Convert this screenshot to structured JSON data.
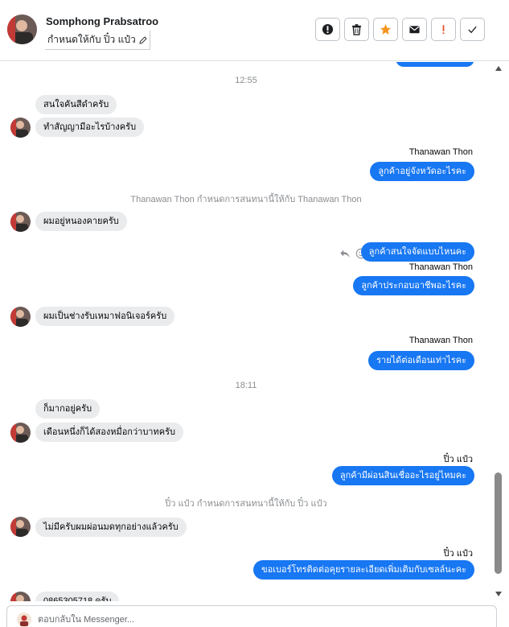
{
  "header": {
    "contact_name": "Somphong Prabsatroo",
    "assign_label": "กำหนดให้กับ ปิ๋ว แป๋ว",
    "toolbar": [
      {
        "name": "report-button",
        "icon": "exclamation-circle-icon"
      },
      {
        "name": "delete-button",
        "icon": "trash-icon"
      },
      {
        "name": "star-button",
        "icon": "star-icon"
      },
      {
        "name": "mark-unread-button",
        "icon": "envelope-icon"
      },
      {
        "name": "spam-button",
        "icon": "exclamation-icon"
      },
      {
        "name": "done-button",
        "icon": "check-icon"
      }
    ]
  },
  "conversation": {
    "timestamp1": "12:55",
    "m1": "สนใจคันสีดำครับ",
    "m2": "ทำสัญญามีอะไรบ้างครับ",
    "sender1": "Thanawan Thon",
    "m3": "ลูกค้าอยู่จังหวัดอะไรคะ",
    "note1": "Thanawan Thon กำหนดการสนทนานี้ให้กับ Thanawan Thon",
    "m4": "ผมอยู่หนองคายครับ",
    "m5": "ลูกค้าสนใจจัดแบบไหนคะ",
    "sender2": "Thanawan Thon",
    "m6": "ลูกค้าประกอบอาชีพอะไรคะ",
    "m7": "ผมเป็นช่างรับเหมาฟอนิเจอร์ครับ",
    "sender3": "Thanawan Thon",
    "m8": "รายได้ต่อเดือนเท่าไรคะ",
    "timestamp2": "18:11",
    "m9": "ก็มากอยู่ครับ",
    "m10": "เดือนหนึ่งก็ได้สองหมื่อกว่าบาทครับ",
    "sender4": "ปิ๋ว แป๋ว",
    "m11": "ลูกค้ามีผ่อนสินเชื่ออะไรอยู่ไหมคะ",
    "note2": "ปิ๋ว แป๋ว กำหนดการสนทนานี้ให้กับ ปิ๋ว แป๋ว",
    "m12": "ไม่มีครับผมผ่อนมดทุกอย่างแล้วครับ",
    "sender5": "ปิ๋ว แป๋ว",
    "m13": "ขอเบอร์โทรติดต่อคุยรายละเอียดเพิ่มเติมกับเซลล์นะคะ",
    "m14": "0865305718 ครับ"
  },
  "composer": {
    "placeholder": "ตอบกลับใน Messenger..."
  },
  "colors": {
    "outgoing": "#1877f2",
    "incoming": "#eaebec",
    "star": "#f7931e",
    "spam": "#e4572e"
  }
}
